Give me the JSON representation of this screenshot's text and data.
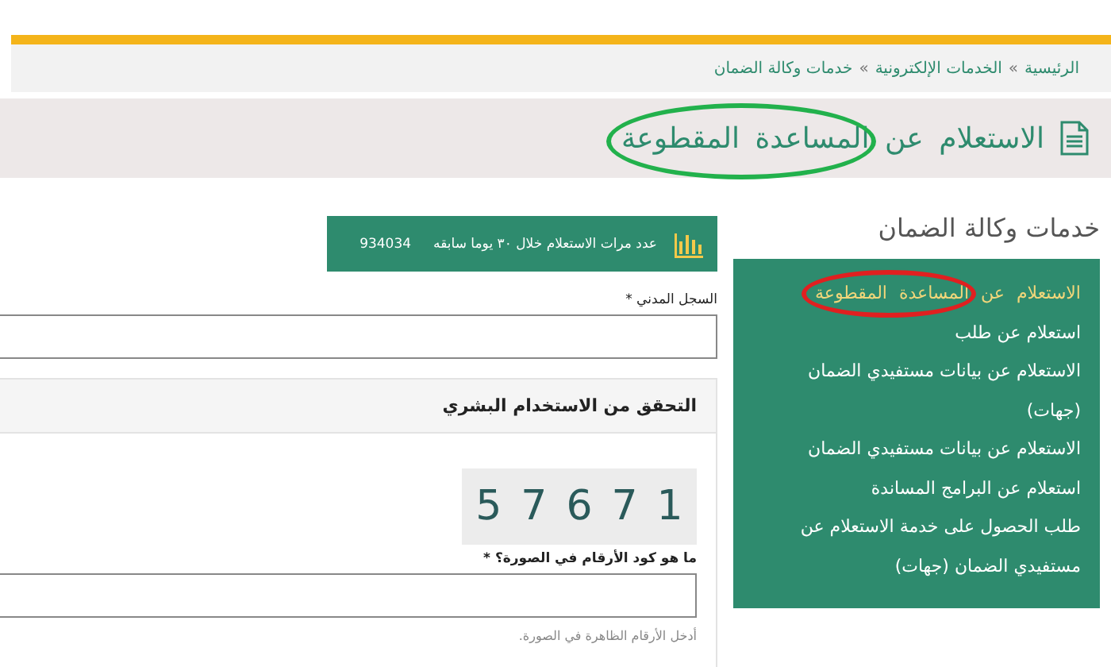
{
  "breadcrumb": [
    "الرئيسية",
    "الخدمات الإلكترونية",
    "خدمات وكالة الضمان"
  ],
  "breadcrumb_separator": "»",
  "page_title": {
    "text": "الاستعلام عن المساعدة المقطوعة",
    "highlight": {
      "color": "#22b14c"
    }
  },
  "stats": {
    "label": "عدد مرات الاستعلام خلال ٣٠ يوما سابقه",
    "value": "934034"
  },
  "civil_id": {
    "label": "السجل المدني *"
  },
  "captcha_panel": {
    "title": "التحقق من الاستخدام البشري",
    "captcha_code": "57671",
    "label": "ما هو كود الأرقام في الصورة؟ *",
    "hint": "أدخل الأرقام الظاهرة في الصورة."
  },
  "sidebar": {
    "title": "خدمات وكالة الضمان",
    "items": [
      {
        "text": "الاستعلام عن المساعدة المقطوعة",
        "selected": true,
        "highlight": {
          "color": "#e02020"
        }
      },
      {
        "text": "استعلام عن طلب",
        "selected": false
      },
      {
        "text": "الاستعلام عن بيانات مستفيدي الضمان (جهات)",
        "selected": false
      },
      {
        "text": "الاستعلام عن بيانات مستفيدي الضمان",
        "selected": false
      },
      {
        "text": "استعلام عن البرامج المساندة",
        "selected": false
      },
      {
        "text": "طلب الحصول على خدمة الاستعلام عن مستفيدي الضمان (جهات)",
        "selected": false
      }
    ]
  }
}
